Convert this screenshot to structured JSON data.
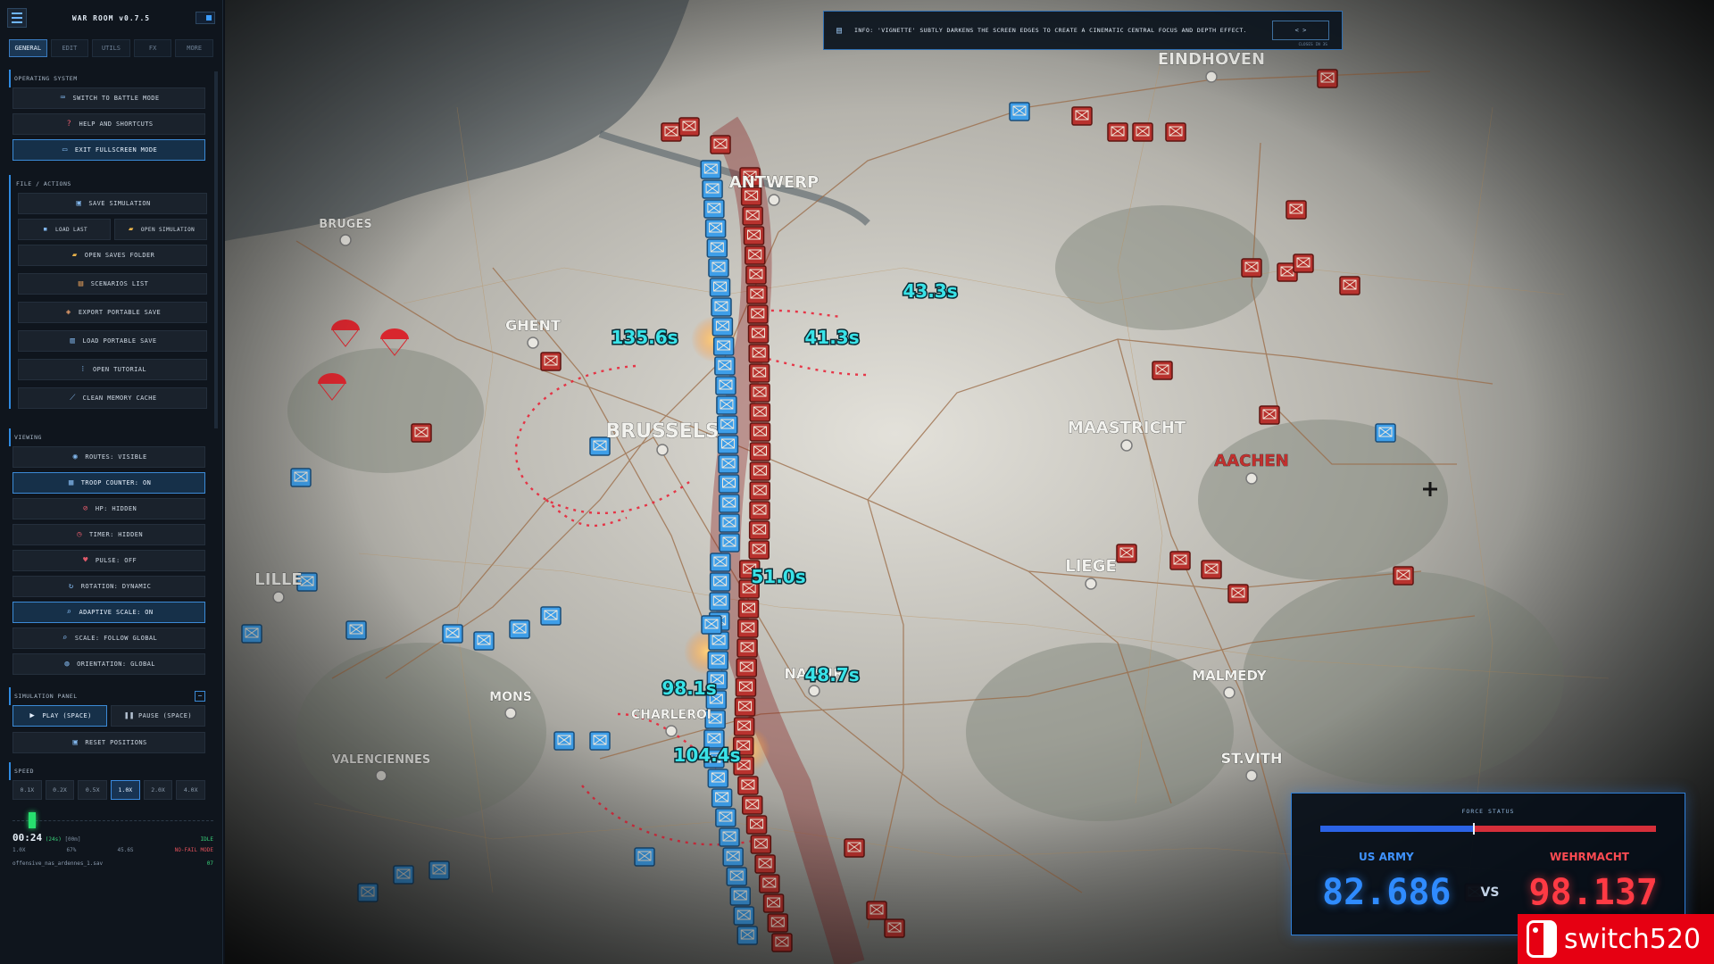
{
  "app": {
    "title": "WAR ROOM v0.7.5"
  },
  "tabs": [
    {
      "label": "GENERAL",
      "active": true
    },
    {
      "label": "EDIT"
    },
    {
      "label": "UTILS"
    },
    {
      "label": "FX"
    },
    {
      "label": "MORE"
    }
  ],
  "sections": {
    "os": {
      "label": "OPERATING SYSTEM",
      "buttons": [
        {
          "label": "SWITCH TO BATTLE MODE",
          "icon": "gamepad-icon"
        },
        {
          "label": "HELP AND SHORTCUTS",
          "icon": "question-icon"
        },
        {
          "label": "EXIT FULLSCREEN MODE",
          "icon": "monitor-icon",
          "highlight": true
        }
      ]
    },
    "file": {
      "label": "FILE / ACTIONS",
      "save": "SAVE SIMULATION",
      "load_last": "LOAD LAST",
      "open_sim": "OPEN SIMULATION",
      "open_folder": "OPEN SAVES FOLDER",
      "scenarios": "SCENARIOS LIST",
      "export": "EXPORT PORTABLE SAVE",
      "load_portable": "LOAD PORTABLE SAVE",
      "tutorial": "OPEN TUTORIAL",
      "clean": "CLEAN MEMORY CACHE"
    },
    "viewing": {
      "label": "VIEWING",
      "routes": "ROUTES: VISIBLE",
      "troop": "TROOP COUNTER: ON",
      "hp": "HP: HIDDEN",
      "timer": "TIMER: HIDDEN",
      "pulse": "PULSE: OFF",
      "rotation": "ROTATION: DYNAMIC",
      "adaptive": "ADAPTIVE SCALE: ON",
      "scale": "SCALE: FOLLOW GLOBAL",
      "orientation": "ORIENTATION: GLOBAL"
    },
    "sim": {
      "label": "SIMULATION PANEL",
      "play": "PLAY (SPACE)",
      "pause": "PAUSE (SPACE)",
      "reset": "RESET POSITIONS",
      "speed_label": "SPEED",
      "speeds": [
        "0.1X",
        "0.2X",
        "0.5X",
        "1.0X",
        "2.0X",
        "4.0X"
      ],
      "active_speed": "1.0X",
      "clock": "00:24",
      "clock_sub": "(24s)",
      "clock_sub2": "[00m]",
      "status": "IDLE",
      "s1": "1.0X",
      "s2": "67%",
      "s3": "45.6S",
      "s4": "NO-FAIL MODE",
      "file": "offensive_nas_ardennes_1.sav",
      "file_count": "07"
    }
  },
  "banner": {
    "text": "INFO: 'VIGNETTE' SUBTLY DARKENS THE SCREEN EDGES TO CREATE A CINEMATIC CENTRAL FOCUS AND DEPTH EFFECT.",
    "button": "< >",
    "sub": "CLOSES IN 3S"
  },
  "cities": [
    {
      "name": "EINDHOVEN"
    },
    {
      "name": "ANTWERP"
    },
    {
      "name": "BRUGES"
    },
    {
      "name": "GHENT"
    },
    {
      "name": "BRUSSELS"
    },
    {
      "name": "MAASTRICHT"
    },
    {
      "name": "AACHEN"
    },
    {
      "name": "LIEGE"
    },
    {
      "name": "LILLE"
    },
    {
      "name": "NAMUR"
    },
    {
      "name": "MONS"
    },
    {
      "name": "VALENCIENNES"
    },
    {
      "name": "CHARLEROI"
    },
    {
      "name": "MALMEDY"
    },
    {
      "name": "ST.VITH"
    }
  ],
  "timers": [
    "135.6s",
    "43.3s",
    "41.3s",
    "51.0s",
    "48.7s",
    "98.1s",
    "104.4s"
  ],
  "force": {
    "title": "FORCE STATUS",
    "left_name": "US ARMY",
    "left_value": "82.686",
    "vs": "VS",
    "right_name": "WEHRMACHT",
    "right_value": "98.137",
    "left_share": 0.457,
    "colors": {
      "us": "#2f8bff",
      "de": "#ff3a44"
    }
  },
  "watermark": {
    "text": "switch520"
  }
}
